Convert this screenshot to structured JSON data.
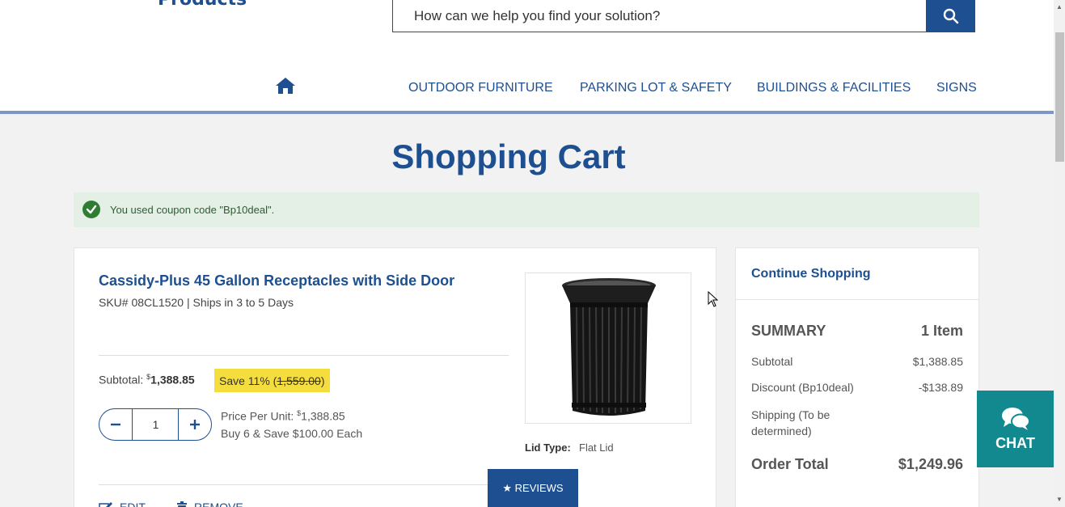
{
  "header": {
    "logo_text": "Products",
    "search": {
      "placeholder": "How can we help you find your solution?",
      "icon": "search-icon"
    },
    "nav": {
      "home_icon": "home-icon",
      "items": [
        "OUTDOOR FURNITURE",
        "PARKING LOT & SAFETY",
        "BUILDINGS & FACILITIES",
        "SIGNS"
      ]
    }
  },
  "page": {
    "title": "Shopping Cart"
  },
  "coupon_notice": {
    "text": "You used coupon code \"Bp10deal\".",
    "icon": "check-circle-icon"
  },
  "cart_item": {
    "name": "Cassidy-Plus 45 Gallon Receptacles with Side Door",
    "meta": "SKU# 08CL1520 | Ships in 3 to 5 Days",
    "subtotal_label": "Subtotal:",
    "subtotal_currency": "$",
    "subtotal_value": "1,388.85",
    "save_text": "Save 11% (",
    "original_price": "1,559.00",
    "save_close": ")",
    "quantity": "1",
    "unit_price_label": "Price Per Unit:",
    "unit_price_currency": "$",
    "unit_price_value": "1,388.85",
    "bulk_offer": "Buy 6 & Save $100.00 Each",
    "lid_type_label": "Lid Type:",
    "lid_type_value": "Flat Lid",
    "edit_label": "EDIT",
    "remove_label": "REMOVE",
    "image_alt": "black slatted trash receptacle"
  },
  "reviews_tab": {
    "label": "★ REVIEWS"
  },
  "summary": {
    "continue_label": "Continue Shopping",
    "heading": "SUMMARY",
    "item_count": "1 Item",
    "rows": [
      {
        "label": "Subtotal",
        "value": "$1,388.85"
      },
      {
        "label": "Discount (Bp10deal)",
        "value": "-$138.89"
      },
      {
        "label": "Shipping (To be determined)",
        "value": ""
      }
    ],
    "order_total_label": "Order Total",
    "order_total_value": "$1,249.96"
  },
  "chat": {
    "label": "CHAT",
    "icon": "chat-bubbles-icon"
  },
  "colors": {
    "brand_blue": "#1d4f91",
    "chat_teal": "#12888f",
    "save_yellow": "#f5dd3d",
    "success_green": "#2e7d32"
  }
}
